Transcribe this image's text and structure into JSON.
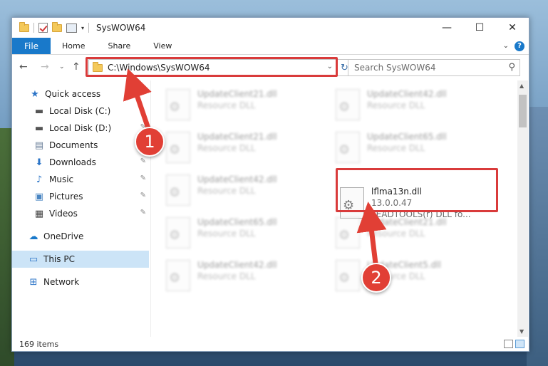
{
  "window": {
    "title": "SysWOW64",
    "controls": {
      "minimize": "—",
      "maximize": "☐",
      "close": "✕"
    }
  },
  "ribbon": {
    "file": "File",
    "tabs": [
      "Home",
      "Share",
      "View"
    ],
    "help": "?"
  },
  "addressbar": {
    "path": "C:\\Windows\\SysWOW64",
    "search_placeholder": "Search SysWOW64"
  },
  "sidebar": {
    "items": [
      {
        "label": "Quick access",
        "icon": "star-icon",
        "pinned": false
      },
      {
        "label": "Local Disk (C:)",
        "icon": "drive-icon",
        "pinned": false
      },
      {
        "label": "Local Disk (D:)",
        "icon": "drive-icon",
        "pinned": true
      },
      {
        "label": "Documents",
        "icon": "documents-icon",
        "pinned": true
      },
      {
        "label": "Downloads",
        "icon": "download-icon",
        "pinned": true
      },
      {
        "label": "Music",
        "icon": "music-icon",
        "pinned": true
      },
      {
        "label": "Pictures",
        "icon": "pictures-icon",
        "pinned": true
      },
      {
        "label": "Videos",
        "icon": "videos-icon",
        "pinned": true
      },
      {
        "label": "OneDrive",
        "icon": "cloud-icon",
        "pinned": false
      },
      {
        "label": "This PC",
        "icon": "computer-icon",
        "pinned": false,
        "selected": true
      },
      {
        "label": "Network",
        "icon": "network-icon",
        "pinned": false
      }
    ]
  },
  "files": [
    {
      "name": "UpdateClient21.dll",
      "type": "Resource DLL"
    },
    {
      "name": "UpdateClient42.dll",
      "type": "Resource DLL"
    },
    {
      "name": "UpdateClient21.dll",
      "type": "Resource DLL"
    },
    {
      "name": "UpdateClient65.dll",
      "type": "Resource DLL"
    },
    {
      "name": "UpdateClient42.dll",
      "type": "Resource DLL"
    },
    {
      "name": "lflma13n.dll",
      "version": "13.0.0.47",
      "type": "LEADTOOLS(r) DLL fo...",
      "highlighted": true
    },
    {
      "name": "UpdateClient65.dll",
      "type": "Resource DLL"
    },
    {
      "name": "UpdateClient21.dll",
      "type": "Resource DLL"
    },
    {
      "name": "UpdateClient42.dll",
      "type": "Resource DLL"
    },
    {
      "name": "UpdateClient5.dll",
      "type": "Resource DLL"
    }
  ],
  "status": {
    "count": "169 items"
  },
  "annotations": {
    "badge1": "1",
    "badge2": "2",
    "color": "#d93b3b"
  }
}
